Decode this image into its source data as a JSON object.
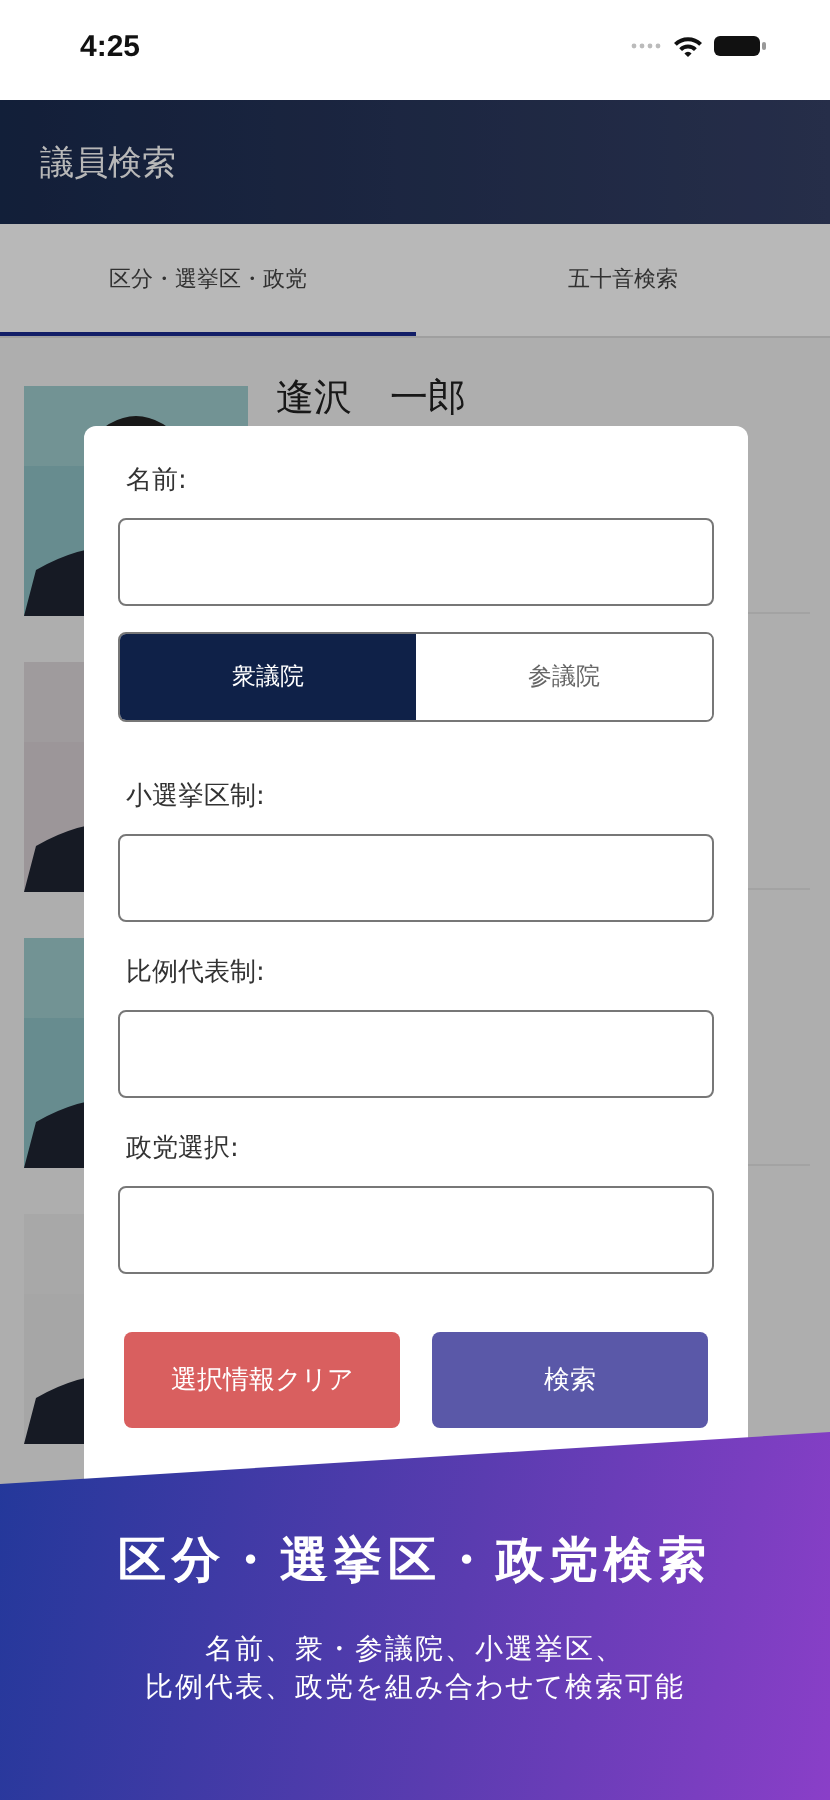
{
  "status_bar": {
    "time": "4:25"
  },
  "header": {
    "title": "議員検索"
  },
  "tabs": [
    {
      "label": "区分・選挙区・政党",
      "selected": true
    },
    {
      "label": "五十音検索",
      "selected": false
    }
  ],
  "members": [
    {
      "kind": "picture",
      "name": "逢沢　一郎"
    },
    {
      "kind": "picture"
    },
    {
      "kind": "picture"
    },
    {
      "kind": "picture"
    }
  ],
  "dialog": {
    "fields": [
      {
        "kind": "text",
        "label": "名前:"
      },
      {
        "kind": "segmented",
        "options": [
          {
            "label": "衆議院",
            "selected": true
          },
          {
            "label": "参議院",
            "selected": false
          }
        ]
      },
      {
        "kind": "text",
        "label": "小選挙区制:"
      },
      {
        "kind": "text",
        "label": "比例代表制:"
      },
      {
        "kind": "text",
        "label": "政党選択:"
      }
    ],
    "buttons": [
      {
        "kind": "clear",
        "label": "選択情報クリア"
      },
      {
        "kind": "search",
        "label": "検索"
      }
    ]
  },
  "banner": {
    "title": "区分・選挙区・政党検索",
    "lines": [
      "名前、衆・参議院、小選挙区、",
      "比例代表、政党を組み合わせて検索可能"
    ]
  }
}
